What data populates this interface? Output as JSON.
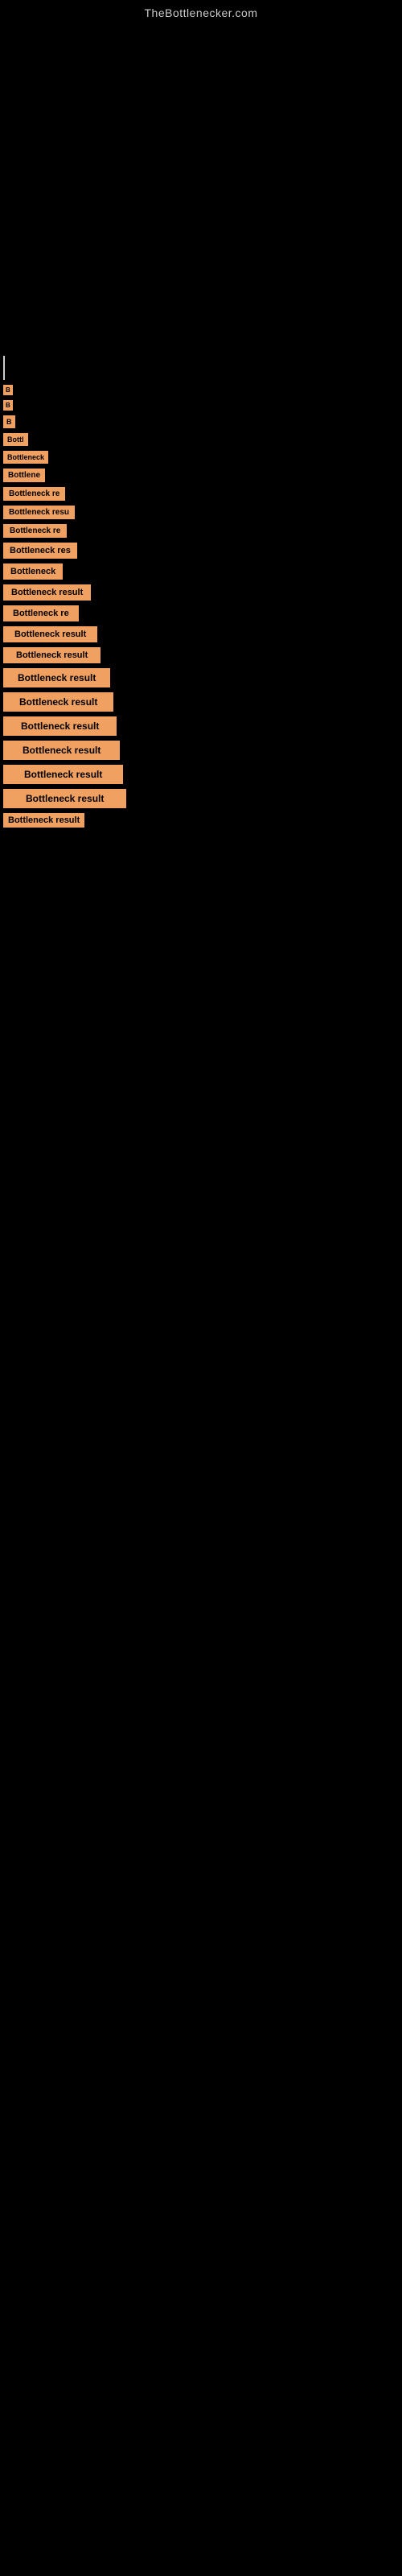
{
  "site": {
    "title": "TheBottlenecker.com"
  },
  "results": [
    {
      "label": "B",
      "id": "result-1"
    },
    {
      "label": "B",
      "id": "result-2"
    },
    {
      "label": "B",
      "id": "result-3"
    },
    {
      "label": "Bottl",
      "id": "result-4"
    },
    {
      "label": "Bottleneck",
      "id": "result-5"
    },
    {
      "label": "Bottlene",
      "id": "result-6"
    },
    {
      "label": "Bottleneck re",
      "id": "result-7"
    },
    {
      "label": "Bottleneck resu",
      "id": "result-8"
    },
    {
      "label": "Bottleneck re",
      "id": "result-9"
    },
    {
      "label": "Bottleneck res",
      "id": "result-10"
    },
    {
      "label": "Bottleneck",
      "id": "result-11"
    },
    {
      "label": "Bottleneck result",
      "id": "result-12"
    },
    {
      "label": "Bottleneck re",
      "id": "result-13"
    },
    {
      "label": "Bottleneck result",
      "id": "result-14"
    },
    {
      "label": "Bottleneck result",
      "id": "result-15"
    },
    {
      "label": "Bottleneck result",
      "id": "result-16"
    },
    {
      "label": "Bottleneck result",
      "id": "result-17"
    },
    {
      "label": "Bottleneck result",
      "id": "result-18"
    },
    {
      "label": "Bottleneck result",
      "id": "result-19"
    },
    {
      "label": "Bottleneck result",
      "id": "result-20"
    },
    {
      "label": "Bottleneck result",
      "id": "result-21"
    },
    {
      "label": "Bottleneck result",
      "id": "result-22"
    }
  ]
}
